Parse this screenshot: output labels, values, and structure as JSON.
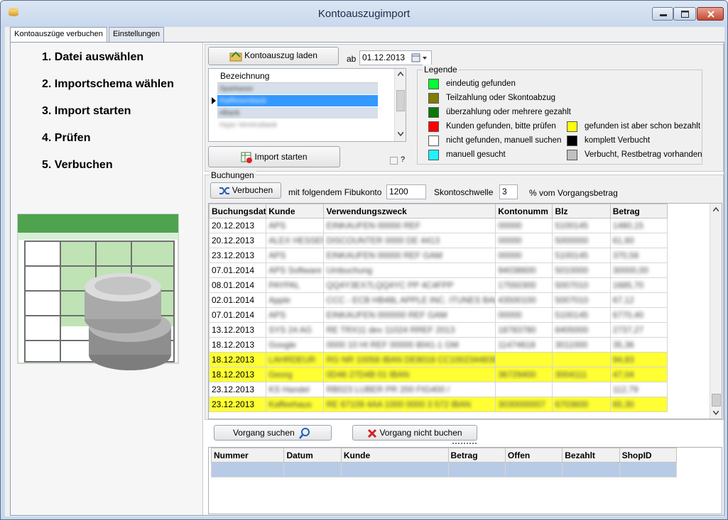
{
  "window": {
    "title": "Kontoauszugimport"
  },
  "tabs": [
    {
      "label": "Kontoauszüge verbuchen"
    },
    {
      "label": "Einstellungen"
    }
  ],
  "steps": [
    "1. Datei auswählen",
    "2. Importschema wählen",
    "3. Import starten",
    "4. Prüfen",
    "5. Verbuchen"
  ],
  "import": {
    "load_button": "Kontoauszug laden",
    "from_label": "ab",
    "from_date": "01.12.2013",
    "start_button": "Import starten",
    "checkbox_label": "?",
    "accounts_header": "Bezeichnung",
    "accounts": [
      "Sparkasse",
      "Raiffeisenbank",
      "eBank",
      "Hypo Vereinsbank"
    ]
  },
  "legend": {
    "title": "Legende",
    "left": [
      {
        "color": "#00ff33",
        "label": "eindeutig gefunden"
      },
      {
        "color": "#807c00",
        "label": "Teilzahlung oder Skontoabzug"
      },
      {
        "color": "#087a08",
        "label": "überzahlung oder mehrere gezahlt"
      },
      {
        "color": "#ff0000",
        "label": "Kunden gefunden, bitte prüfen"
      },
      {
        "color": "#ffffff",
        "label": "nicht gefunden, manuell suchen"
      },
      {
        "color": "#22f2ff",
        "label": "manuell gesucht"
      }
    ],
    "right": [
      {
        "color": "#ffff00",
        "label": "gefunden ist aber schon bezahlt"
      },
      {
        "color": "#000000",
        "label": "komplett Verbucht"
      },
      {
        "color": "#c0c0c0",
        "label": "Verbucht, Restbetrag vorhanden"
      }
    ]
  },
  "bookings": {
    "title": "Buchungen",
    "verbuchen_button": "Verbuchen",
    "fibu_label": "mit folgendem Fibukonto",
    "fibu_value": "1200",
    "skonto_label": "Skontoschwelle",
    "skonto_value": "3",
    "percent_label": "% vom Vorgangsbetrag",
    "columns": [
      "Buchungsdat",
      "Kunde",
      "Verwendungszweck",
      "Kontonumm",
      "Blz",
      "Betrag"
    ],
    "rows": [
      {
        "date": "20.12.2013",
        "kunde": "APS",
        "zweck": "EINKAUFEN 00000 REF",
        "konto": "00000",
        "blz": "5100145",
        "betrag": "1480,15",
        "hl": false
      },
      {
        "date": "20.12.2013",
        "kunde": "ALEX HESSEN",
        "zweck": "DISCOUNTER 0000 DE 4413",
        "konto": "00000",
        "blz": "5000000",
        "betrag": "61,60",
        "hl": false
      },
      {
        "date": "23.12.2013",
        "kunde": "APS",
        "zweck": "EINKAUFEN 00000 REF GAM",
        "konto": "00000",
        "blz": "5100145",
        "betrag": "370,56",
        "hl": false
      },
      {
        "date": "07.01.2014",
        "kunde": "APS Software",
        "zweck": "Umbuchung",
        "konto": "94038600",
        "blz": "5010000",
        "betrag": "30000,00",
        "hl": false
      },
      {
        "date": "08.01.2014",
        "kunde": "PAYPAL",
        "zweck": "QQ4Y3EX7LQQ4YC PP 4C4FPP",
        "konto": "17550300",
        "blz": "5007010",
        "betrag": "1685,70",
        "hl": false
      },
      {
        "date": "02.01.2014",
        "kunde": "Apple",
        "zweck": "CCC - ECB HB48L APPLE INC. ITUNES BAL",
        "konto": "43500100",
        "blz": "5007010",
        "betrag": "67,12",
        "hl": false
      },
      {
        "date": "07.01.2014",
        "kunde": "APS",
        "zweck": "EINKAUFEN 000000 REF GAM",
        "konto": "00000",
        "blz": "5100145",
        "betrag": "6770,40",
        "hl": false
      },
      {
        "date": "13.12.2013",
        "kunde": "SYS 24 AG",
        "zweck": "RE TRX11 dev 11024 RREF 2013",
        "konto": "18783780",
        "blz": "8405000",
        "betrag": "2737,27",
        "hl": false
      },
      {
        "date": "18.12.2013",
        "kunde": "Google",
        "zweck": "0000 10 HI REF 00000 8041-1 GM",
        "konto": "11474618",
        "blz": "3011000",
        "betrag": "35,36",
        "hl": false
      },
      {
        "date": "18.12.2013",
        "kunde": "LAHRDEUR",
        "zweck": "RG NR 10058 IBAN DE8018 CC1002344839",
        "konto": "",
        "blz": "",
        "betrag": "94,83",
        "hl": true
      },
      {
        "date": "18.12.2013",
        "kunde": "Georg",
        "zweck": "0D46 27D4B 01 IBAN",
        "konto": "36729400",
        "blz": "3004111",
        "betrag": "47,04",
        "hl": true
      },
      {
        "date": "23.12.2013",
        "kunde": "KS Handel",
        "zweck": "RB023 LUBER PR 200 FIG400 /",
        "konto": "",
        "blz": "",
        "betrag": "112,79",
        "hl": false
      },
      {
        "date": "23.12.2013",
        "kunde": "Kaffeehaus",
        "zweck": "RE 67109 4AA 1000 0000 3 572 IBAN",
        "konto": "3030000007",
        "blz": "6703600",
        "betrag": "65,30",
        "hl": true
      }
    ]
  },
  "search": {
    "search_button": "Vorgang suchen",
    "no_book_button": "Vorgang nicht buchen"
  },
  "orders": {
    "columns": [
      "Nummer",
      "Datum",
      "Kunde",
      "Betrag",
      "Offen",
      "Bezahlt",
      "ShopID"
    ]
  }
}
